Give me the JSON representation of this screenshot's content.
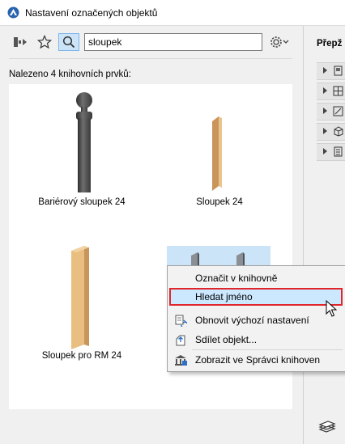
{
  "window": {
    "title": "Nastavení označených objektů"
  },
  "toolbar": {
    "search_value": "sloupek"
  },
  "results": {
    "label": "Nalezeno 4 knihovních prvků:"
  },
  "items": [
    {
      "label": "Bariérový sloupek 24"
    },
    {
      "label": "Sloupek 24"
    },
    {
      "label": "Sloupek pro RM 24"
    },
    {
      "label": ""
    }
  ],
  "context_menu": {
    "items": [
      {
        "label": "Označit v knihovně",
        "icon": ""
      },
      {
        "label": "Hledat jméno",
        "icon": "",
        "highlighted": true
      },
      {
        "label": "Obnovit výchozí nastavení",
        "icon": "reset-icon"
      },
      {
        "label": "Sdílet objekt...",
        "icon": "share-icon"
      },
      {
        "label": "Zobrazit ve Správci knihoven",
        "icon": "library-manager-icon"
      }
    ]
  },
  "right_panel": {
    "title": "Přepž"
  },
  "colors": {
    "selection": "#cce4f7",
    "highlight_border": "#e0262b",
    "wood": "#e2b877",
    "metal": "#4a4a4a"
  }
}
